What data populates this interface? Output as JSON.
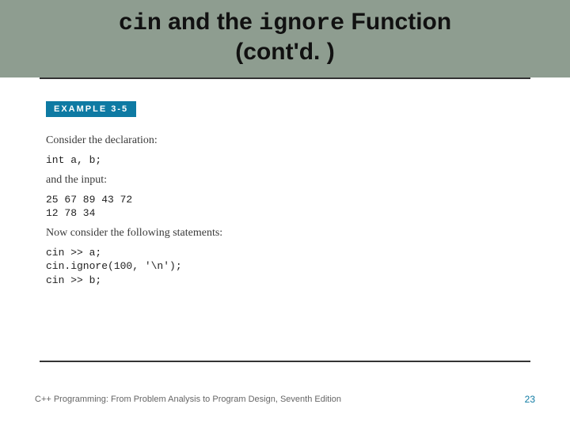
{
  "header": {
    "title_code1": "cin",
    "title_mid": " and the ",
    "title_code2": "ignore",
    "title_tail": " Function",
    "subtitle": "(cont'd. )"
  },
  "example": {
    "tag": "EXAMPLE 3-5",
    "intro1": "Consider the declaration:",
    "decl": "int a, b;",
    "intro2": "and the input:",
    "input_line1": "25 67 89 43 72",
    "input_line2": "12 78 34",
    "intro3": "Now consider the following statements:",
    "stmt1": "cin >> a;",
    "stmt2": "cin.ignore(100, '\\n');",
    "stmt3": "cin >> b;"
  },
  "footer": {
    "text": "C++ Programming: From Problem Analysis to Program Design, Seventh Edition",
    "page": "23"
  }
}
